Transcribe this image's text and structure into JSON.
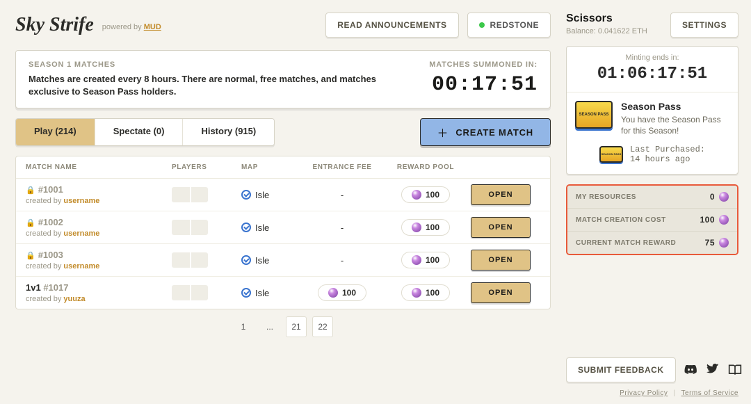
{
  "header": {
    "logo": "Sky Strife",
    "powered_prefix": "powered by ",
    "powered_name": "MUD",
    "announcements_btn": "Read Announcements",
    "network": "REDSTONE"
  },
  "season": {
    "label": "Season 1 Matches",
    "desc": "Matches are created every 8 hours. There are normal, free matches, and matches exclusive to Season Pass holders.",
    "countdown_label": "Matches Summoned In:",
    "countdown": "00:17:51"
  },
  "tabs": {
    "play": {
      "label": "Play",
      "count": "(214)"
    },
    "spectate": {
      "label": "Spectate",
      "count": "(0)"
    },
    "history": {
      "label": "History",
      "count": "(915)"
    }
  },
  "create_btn": "Create Match",
  "table": {
    "headers": {
      "name": "Match Name",
      "players": "Players",
      "map": "Map",
      "fee": "Entrance Fee",
      "reward": "Reward Pool",
      "action": ""
    },
    "rows": [
      {
        "locked": true,
        "prefix": "",
        "id": "#1001",
        "creator": "username",
        "map": "Isle",
        "fee": "-",
        "reward": "100",
        "open": "Open"
      },
      {
        "locked": true,
        "prefix": "",
        "id": "#1002",
        "creator": "username",
        "map": "Isle",
        "fee": "-",
        "reward": "100",
        "open": "Open"
      },
      {
        "locked": true,
        "prefix": "",
        "id": "#1003",
        "creator": "username",
        "map": "Isle",
        "fee": "-",
        "reward": "100",
        "open": "Open"
      },
      {
        "locked": false,
        "prefix": "1v1 ",
        "id": "#1017",
        "creator": "yuuza",
        "map": "Isle",
        "fee": "100",
        "reward": "100",
        "open": "Open"
      }
    ],
    "created_prefix": "created by "
  },
  "pager": {
    "first": "1",
    "ellipsis": "...",
    "p21": "21",
    "p22": "22"
  },
  "side": {
    "name": "Scissors",
    "balance": "Balance: 0.041622 ETH",
    "settings": "Settings",
    "mint_label": "Minting ends in:",
    "mint_time": "01:06:17:51",
    "sp_title": "Season Pass",
    "sp_desc": "You have the Season Pass for this Season!",
    "sp_badge": "SEASON PASS",
    "lp_label": "Last Purchased:",
    "lp_time": "14 hours ago",
    "resources": [
      {
        "label": "My Resources",
        "value": "0"
      },
      {
        "label": "Match Creation Cost",
        "value": "100"
      },
      {
        "label": "Current Match Reward",
        "value": "75"
      }
    ],
    "feedback": "Submit Feedback",
    "privacy": "Privacy Policy",
    "tos": "Terms of Service"
  }
}
